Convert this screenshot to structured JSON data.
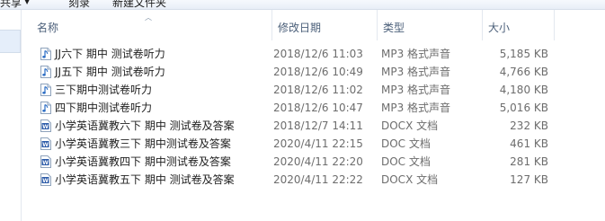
{
  "toolbar": {
    "share_label": "共享",
    "burn_label": "刻录",
    "new_folder_label": "新建文件夹"
  },
  "columns": {
    "name": "名称",
    "date": "修改日期",
    "type": "类型",
    "size": "大小"
  },
  "files": [
    {
      "name": "JJ六下 期中 测试卷听力",
      "date": "2018/12/6 11:03",
      "type": "MP3 格式声音",
      "size": "5,185 KB",
      "icon": "audio-file-icon"
    },
    {
      "name": "JJ五下 期中 测试卷听力",
      "date": "2018/12/6 10:49",
      "type": "MP3 格式声音",
      "size": "4,766 KB",
      "icon": "audio-file-icon"
    },
    {
      "name": "三下期中测试卷听力",
      "date": "2018/12/6 11:02",
      "type": "MP3 格式声音",
      "size": "4,180 KB",
      "icon": "audio-file-icon"
    },
    {
      "name": "四下期中测试卷听力",
      "date": "2018/12/6 10:47",
      "type": "MP3 格式声音",
      "size": "5,016 KB",
      "icon": "audio-file-icon"
    },
    {
      "name": "小学英语冀教六下 期中 测试卷及答案",
      "date": "2018/12/7 14:11",
      "type": "DOCX 文档",
      "size": "232 KB",
      "icon": "word-file-icon"
    },
    {
      "name": "小学英语冀教三下 期中测试卷及答案",
      "date": "2020/4/11 22:15",
      "type": "DOC 文档",
      "size": "461 KB",
      "icon": "word-file-icon"
    },
    {
      "name": "小学英语冀教四下 期中测试卷及答案",
      "date": "2020/4/11 22:20",
      "type": "DOC 文档",
      "size": "281 KB",
      "icon": "word-file-icon"
    },
    {
      "name": "小学英语冀教五下 期中 测试卷及答案",
      "date": "2020/4/11 22:22",
      "type": "DOCX 文档",
      "size": "127 KB",
      "icon": "word-file-icon"
    }
  ]
}
